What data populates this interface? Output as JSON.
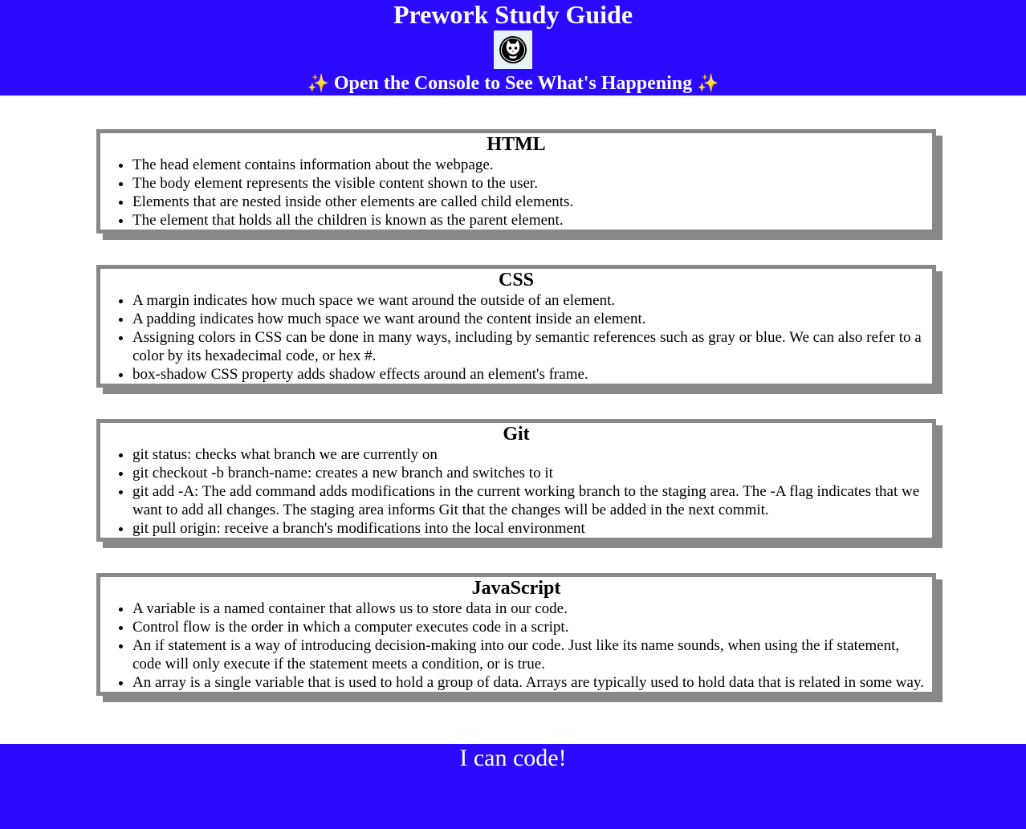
{
  "header": {
    "title": "Prework Study Guide",
    "logo_icon": "cat-logo-icon",
    "subtitle": "Open the Console to See What's Happening",
    "sparkle": "✨",
    "background": "#2b0aff"
  },
  "sections": [
    {
      "heading": "HTML",
      "items": [
        "The head element contains information about the webpage.",
        "The body element represents the visible content shown to the user.",
        "Elements that are nested inside other elements are called child elements.",
        "The element that holds all the children is known as the parent element."
      ]
    },
    {
      "heading": "CSS",
      "items": [
        "A margin indicates how much space we want around the outside of an element.",
        "A padding indicates how much space we want around the content inside an element.",
        "Assigning colors in CSS can be done in many ways, including by semantic references such as gray or blue. We can also refer to a color by its hexadecimal code, or hex #.",
        "box-shadow CSS property adds shadow effects around an element's frame."
      ]
    },
    {
      "heading": "Git",
      "items": [
        "git status: checks what branch we are currently on",
        "git checkout -b branch-name: creates a new branch and switches to it",
        "git add -A: The add command adds modifications in the current working branch to the staging area. The -A flag indicates that we want to add all changes. The staging area informs Git that the changes will be added in the next commit.",
        "git pull origin: receive a branch's modifications into the local environment"
      ]
    },
    {
      "heading": "JavaScript",
      "items": [
        "A variable is a named container that allows us to store data in our code.",
        "Control flow is the order in which a computer executes code in a script.",
        "An if statement is a way of introducing decision-making into our code. Just like its name sounds, when using the if statement, code will only execute if the statement meets a condition, or is true.",
        "An array is a single variable that is used to hold a group of data. Arrays are typically used to hold data that is related in some way."
      ]
    }
  ],
  "footer": {
    "text": "I can code!"
  }
}
